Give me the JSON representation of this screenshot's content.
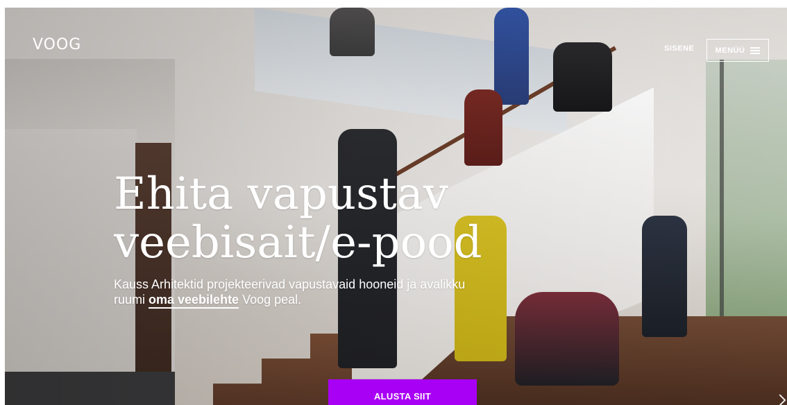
{
  "header": {
    "logo": "VOOG",
    "login_label": "SISENE",
    "menu_label": "MENÜÜ"
  },
  "hero": {
    "headline": "Ehita vapustav veebisait/e-pood",
    "subtext_prefix": "Kauss Arhitektid projekteerivad vapustavaid hooneid ja avalikku ruumi ",
    "subtext_link": "oma veebilehte",
    "subtext_suffix": " Voog peal.",
    "cta_label": "ALUSTA SIIT"
  },
  "colors": {
    "cta": "#a800f5",
    "text": "#ffffff"
  },
  "icons": {
    "menu": "hamburger-icon",
    "next": "chevron-right-icon"
  }
}
